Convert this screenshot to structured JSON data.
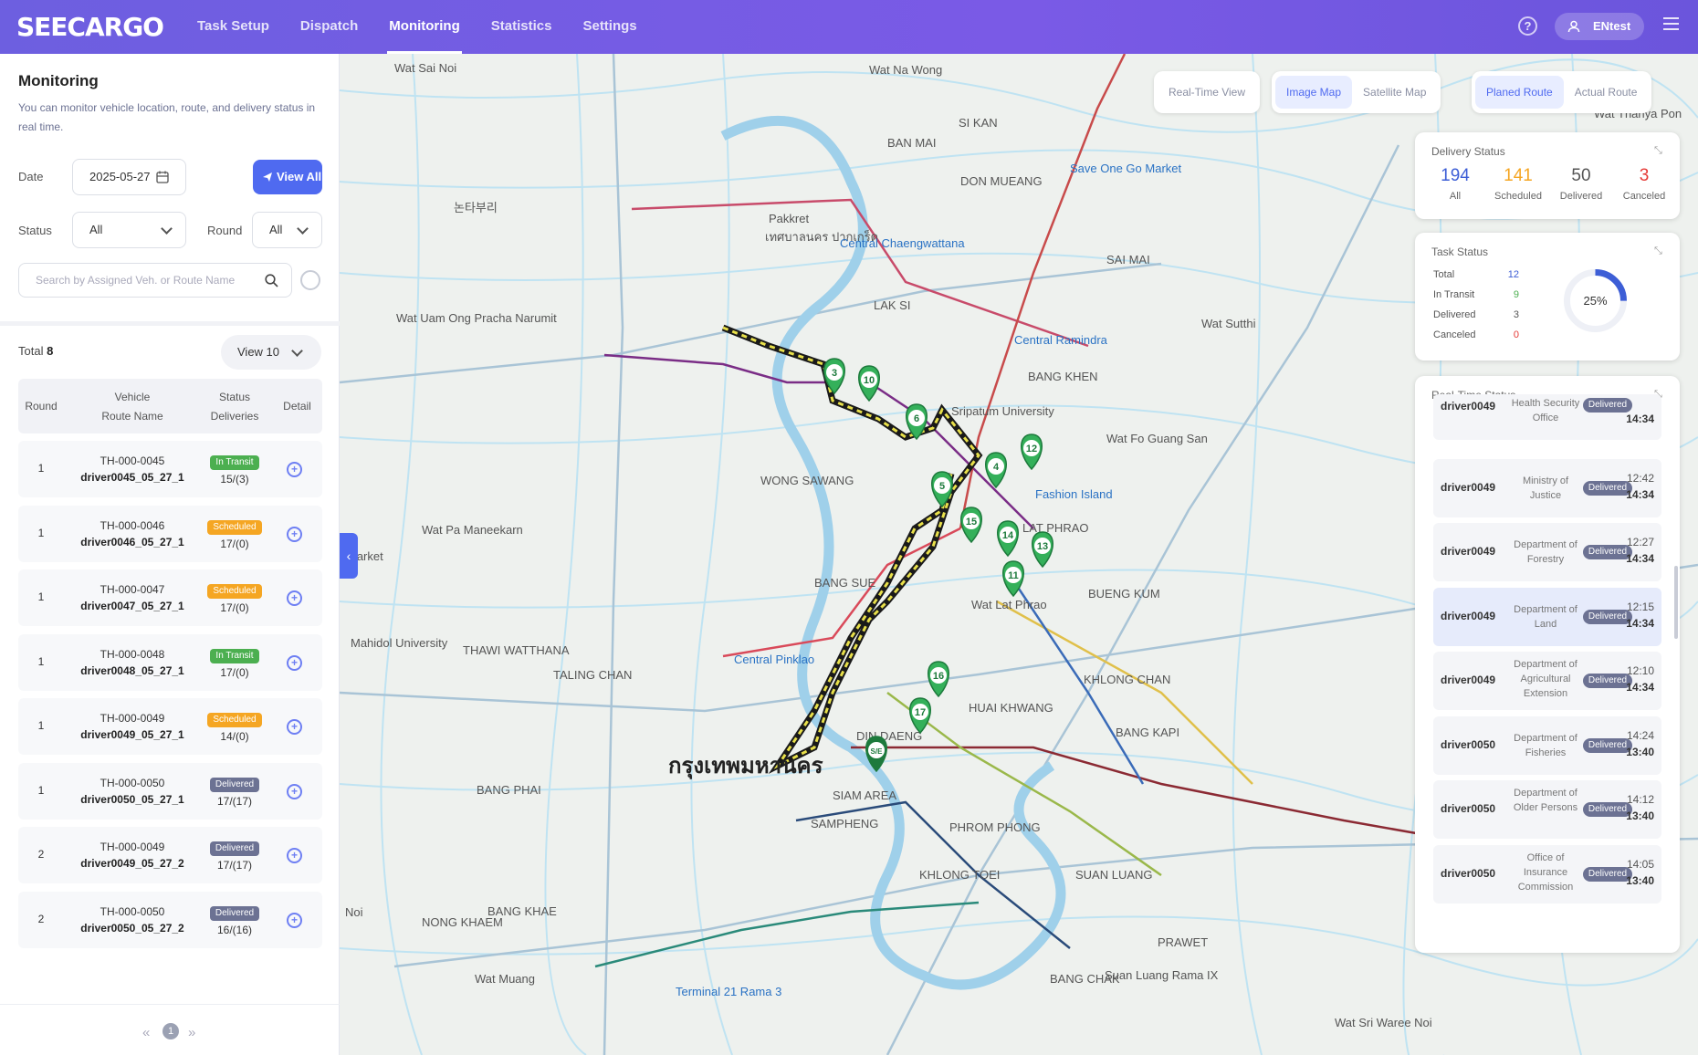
{
  "brand": {
    "logo": "SEECARGO",
    "accent": "#4f6af0",
    "bar": "#6d5fe0"
  },
  "nav": [
    {
      "label": "Task Setup"
    },
    {
      "label": "Dispatch"
    },
    {
      "label": "Monitoring"
    },
    {
      "label": "Statistics"
    },
    {
      "label": "Settings"
    }
  ],
  "header": {
    "help": "?",
    "user": "ENtest"
  },
  "sidebar": {
    "title": "Monitoring",
    "description": "You can monitor vehicle location, route, and delivery status in real time.",
    "date_label": "Date",
    "date_value": "2025-05-27",
    "view_all": "View All",
    "status_label": "Status",
    "status_value": "All",
    "round_label": "Round",
    "round_value": "All",
    "search_placeholder": "Search by Assigned Veh. or Route Name",
    "total_label": "Total",
    "total_value": "8",
    "view_count": "View 10",
    "columns": {
      "round": "Round",
      "vehicle": "Vehicle",
      "route": "Route Name",
      "status": "Status",
      "deliveries": "Deliveries",
      "detail": "Detail"
    },
    "rows": [
      {
        "round": "1",
        "vehicle": "TH-000-0045",
        "route": "driver0045_05_27_1",
        "status": "In Transit",
        "color": "#4caf50",
        "deliveries": "15/(3)"
      },
      {
        "round": "1",
        "vehicle": "TH-000-0046",
        "route": "driver0046_05_27_1",
        "status": "Scheduled",
        "color": "#f5a623",
        "deliveries": "17/(0)"
      },
      {
        "round": "1",
        "vehicle": "TH-000-0047",
        "route": "driver0047_05_27_1",
        "status": "Scheduled",
        "color": "#f5a623",
        "deliveries": "17/(0)"
      },
      {
        "round": "1",
        "vehicle": "TH-000-0048",
        "route": "driver0048_05_27_1",
        "status": "In Transit",
        "color": "#4caf50",
        "deliveries": "17/(0)"
      },
      {
        "round": "1",
        "vehicle": "TH-000-0049",
        "route": "driver0049_05_27_1",
        "status": "Scheduled",
        "color": "#f5a623",
        "deliveries": "14/(0)"
      },
      {
        "round": "1",
        "vehicle": "TH-000-0050",
        "route": "driver0050_05_27_1",
        "status": "Delivered",
        "color": "#6c7293",
        "deliveries": "17/(17)"
      },
      {
        "round": "2",
        "vehicle": "TH-000-0049",
        "route": "driver0049_05_27_2",
        "status": "Delivered",
        "color": "#6c7293",
        "deliveries": "17/(17)"
      },
      {
        "round": "2",
        "vehicle": "TH-000-0050",
        "route": "driver0050_05_27_2",
        "status": "Delivered",
        "color": "#6c7293",
        "deliveries": "16/(16)"
      }
    ],
    "page": "1"
  },
  "map": {
    "toggles": [
      "Real-Time View",
      "Image Map",
      "Satellite Map",
      "Planed Route",
      "Actual Route"
    ],
    "labels": [
      {
        "t": "Wat Sai Noi"
      },
      {
        "t": "Pakkret"
      },
      {
        "t": "เทศบาลนคร ปากเกร็ด"
      },
      {
        "t": "Central Chaengwattana"
      },
      {
        "t": "SI KAN"
      },
      {
        "t": "DON MUEANG"
      },
      {
        "t": "BAN MAI"
      },
      {
        "t": "Wat Na Wong"
      },
      {
        "t": "Save One Go Market"
      },
      {
        "t": "SAI MAI"
      },
      {
        "t": "LAK SI"
      },
      {
        "t": "Central Ramindra"
      },
      {
        "t": "BANG KHEN"
      },
      {
        "t": "Sripatum University"
      },
      {
        "t": "Wat Uam Ong Pracha Narumit"
      },
      {
        "t": "논타부리"
      },
      {
        "t": "WONG SAWANG"
      },
      {
        "t": "Wat Pa Maneekarn"
      },
      {
        "t": "LAT PHRAO"
      },
      {
        "t": "Fashion Island"
      },
      {
        "t": "BANG SUE"
      },
      {
        "t": "BUENG KUM"
      },
      {
        "t": "Wat Lat Phrao"
      },
      {
        "t": "Mahidol University"
      },
      {
        "t": "THAWI WATTHANA"
      },
      {
        "t": "TALING CHAN"
      },
      {
        "t": "Central Pinklao"
      },
      {
        "t": "KHLONG CHAN"
      },
      {
        "t": "HUAI KHWANG"
      },
      {
        "t": "DIN DAENG"
      },
      {
        "t": "BANG KAPI"
      },
      {
        "t": "กรุงเทพมหานคร"
      },
      {
        "t": "BANG PHAI"
      },
      {
        "t": "SAMPHENG"
      },
      {
        "t": "SIAM AREA"
      },
      {
        "t": "PHROM PHONG"
      },
      {
        "t": "KHLONG TOEI"
      },
      {
        "t": "SUAN LUANG"
      },
      {
        "t": "NONG KHAEM"
      },
      {
        "t": "BANG KHAE"
      },
      {
        "t": "Wat Muang"
      },
      {
        "t": "Terminal 21 Rama 3"
      },
      {
        "t": "BANG CHAK"
      },
      {
        "t": "PRAWET"
      },
      {
        "t": "Wat Sri Waree Noi"
      },
      {
        "t": "Wat Thanya Pon"
      },
      {
        "t": "Wat Fo Guang San"
      },
      {
        "t": "Wat Sutthi"
      },
      {
        "t": "Market"
      },
      {
        "t": "Noi"
      },
      {
        "t": "Suan Luang Rama IX"
      }
    ],
    "markers": [
      "3",
      "10",
      "6",
      "12",
      "4",
      "5",
      "15",
      "14",
      "13",
      "11",
      "16",
      "17",
      "S/E"
    ]
  },
  "delivery_status": {
    "title": "Delivery Status",
    "items": [
      {
        "value": "194",
        "label": "All",
        "color": "#3d5ed6"
      },
      {
        "value": "141",
        "label": "Scheduled",
        "color": "#f5a623"
      },
      {
        "value": "50",
        "label": "Delivered",
        "color": "#555555"
      },
      {
        "value": "3",
        "label": "Canceled",
        "color": "#e53935"
      }
    ]
  },
  "task_status": {
    "title": "Task Status",
    "items": [
      {
        "label": "Total",
        "value": "12",
        "color": "#3d5ed6"
      },
      {
        "label": "In Transit",
        "value": "9",
        "color": "#4caf50"
      },
      {
        "label": "Delivered",
        "value": "3",
        "color": "#555555"
      },
      {
        "label": "Canceled",
        "value": "0",
        "color": "#e53935"
      }
    ],
    "percent": "25%",
    "ratio": 0.25
  },
  "realtime": {
    "title": "Real-Time Status",
    "items": [
      {
        "driver": "driver0049",
        "org": "Health Security Office",
        "status": "Delivered",
        "t1": "",
        "t2": "14:34"
      },
      {
        "driver": "driver0049",
        "org": "Ministry of Justice",
        "status": "Delivered",
        "t1": "12:42",
        "t2": "14:34"
      },
      {
        "driver": "driver0049",
        "org": "Department of Forestry",
        "status": "Delivered",
        "t1": "12:27",
        "t2": "14:34"
      },
      {
        "driver": "driver0049",
        "org": "Department of Land",
        "status": "Delivered",
        "t1": "12:15",
        "t2": "14:34"
      },
      {
        "driver": "driver0049",
        "org": "Department of Agricultural Extension",
        "status": "Delivered",
        "t1": "12:10",
        "t2": "14:34"
      },
      {
        "driver": "driver0050",
        "org": "Department of Fisheries",
        "status": "Delivered",
        "t1": "14:24",
        "t2": "13:40"
      },
      {
        "driver": "driver0050",
        "org": "Department of Older Persons",
        "status": "Delivered",
        "t1": "14:12",
        "t2": "13:40"
      },
      {
        "driver": "driver0050",
        "org": "Office of Insurance Commission",
        "status": "Delivered",
        "t1": "14:05",
        "t2": "13:40"
      }
    ]
  }
}
